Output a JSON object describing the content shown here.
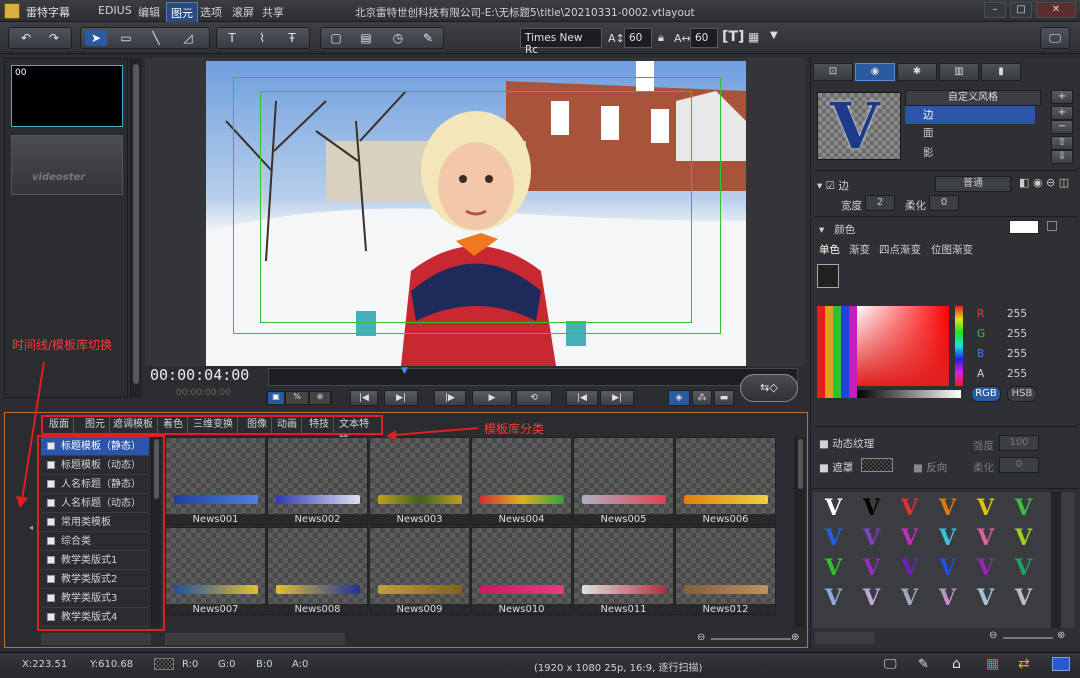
{
  "titlebar": {
    "app_name": "雷特字幕",
    "menus": [
      "EDIUS",
      "编辑",
      "图元",
      "选项",
      "滚屏",
      "共享"
    ],
    "active_menu": "图元",
    "window_title": "北京雷特世创科技有限公司-E:\\无标题5\\title\\20210331-0002.vtlayout"
  },
  "toolbar": {
    "font_name": "Times New Rc",
    "font_size_a": "60",
    "font_size_b": "60"
  },
  "thumbs": {
    "first_label": "00",
    "second_label": "videoster"
  },
  "transport": {
    "timecode": "00:00:04:00",
    "timecode_sub": "00:00:00:00"
  },
  "right_panel": {
    "style_dropdown": "自定义风格",
    "style_items": [
      "边",
      "面",
      "影"
    ],
    "selected_style_item": "边",
    "edge_label": "边",
    "edge_mode": "普通",
    "width_label": "宽度",
    "width_value": "2",
    "soft_label": "柔化",
    "soft_value": "0",
    "color_section": "颜色",
    "color_modes": [
      "单色",
      "渐变",
      "四点渐变",
      "位图渐变"
    ],
    "rgba": [
      {
        "k": "R",
        "v": "255"
      },
      {
        "k": "G",
        "v": "255"
      },
      {
        "k": "B",
        "v": "255"
      },
      {
        "k": "A",
        "v": "255"
      }
    ],
    "rgb_btn": "RGB",
    "hsb_btn": "HSB",
    "dyn_texture": "动态纹理",
    "strength_label": "强度",
    "strength_value": "100",
    "mask_label": "遮罩",
    "invert_label": "反向",
    "soft2_label": "柔化",
    "soft2_value": "0",
    "swatch_colors": [
      "#ffffff",
      "#000000",
      "#e03030",
      "#e07a10",
      "#e0c010",
      "#40c040",
      "#2060e0",
      "#8040c0",
      "#c030c0",
      "#40c0e0",
      "#e060a0",
      "#a0d020"
    ]
  },
  "bottom": {
    "categories": [
      "版面",
      "图元",
      "遮调模板",
      "着色",
      "三维变换",
      "图像",
      "动画",
      "特技",
      "文本特技"
    ],
    "templates": [
      "标题模板（静态）",
      "标题模板（动态）",
      "人名标题（静态）",
      "人名标题（动态）",
      "常用类模板",
      "综合类",
      "教学类版式1",
      "教学类版式2",
      "教学类版式3",
      "教学类版式4"
    ],
    "selected_template": "标题模板（静态）",
    "items": [
      "News001",
      "News002",
      "News003",
      "News004",
      "News005",
      "News006",
      "News007",
      "News008",
      "News009",
      "News010",
      "News011",
      "News012"
    ]
  },
  "annotations": {
    "switch_note": "时间线/模板库切换",
    "category_note": "模板库分类"
  },
  "status": {
    "x": "X:223.51",
    "y": "Y:610.68",
    "r": "R:0",
    "g": "G:0",
    "b": "B:0",
    "a": "A:0",
    "format": "(1920 x 1080 25p, 16:9, 逐行扫描)"
  }
}
